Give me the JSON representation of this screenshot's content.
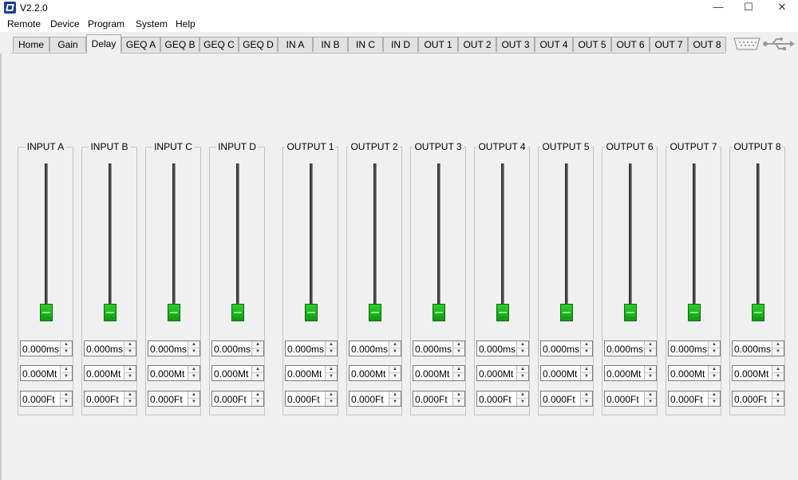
{
  "window": {
    "title": "V2.2.0",
    "minimize_glyph": "—",
    "maximize_glyph": "☐",
    "close_glyph": "✕"
  },
  "menu": [
    "Remote",
    "Device",
    "Program",
    "System",
    "Help"
  ],
  "tabs": [
    {
      "label": "Home",
      "active": false
    },
    {
      "label": "Gain",
      "active": false
    },
    {
      "label": "Delay",
      "active": true
    },
    {
      "label": "GEQ A",
      "active": false
    },
    {
      "label": "GEQ B",
      "active": false
    },
    {
      "label": "GEQ C",
      "active": false
    },
    {
      "label": "GEQ D",
      "active": false
    },
    {
      "label": "IN A",
      "active": false
    },
    {
      "label": "IN B",
      "active": false
    },
    {
      "label": "IN C",
      "active": false
    },
    {
      "label": "IN D",
      "active": false
    },
    {
      "label": "OUT 1",
      "active": false
    },
    {
      "label": "OUT 2",
      "active": false
    },
    {
      "label": "OUT 3",
      "active": false
    },
    {
      "label": "OUT 4",
      "active": false
    },
    {
      "label": "OUT 5",
      "active": false
    },
    {
      "label": "OUT 6",
      "active": false
    },
    {
      "label": "OUT 7",
      "active": false
    },
    {
      "label": "OUT 8",
      "active": false
    }
  ],
  "connector_icons": [
    "serial-port-icon",
    "usb-icon"
  ],
  "accent_color": "#1fb81f",
  "channels": [
    {
      "label": "INPUT A",
      "ms": "0.000ms",
      "mt": "0.000Mt",
      "ft": "0.000Ft",
      "level": 0
    },
    {
      "label": "INPUT B",
      "ms": "0.000ms",
      "mt": "0.000Mt",
      "ft": "0.000Ft",
      "level": 0
    },
    {
      "label": "INPUT C",
      "ms": "0.000ms",
      "mt": "0.000Mt",
      "ft": "0.000Ft",
      "level": 0
    },
    {
      "label": "INPUT D",
      "ms": "0.000ms",
      "mt": "0.000Mt",
      "ft": "0.000Ft",
      "level": 0
    },
    {
      "label": "OUTPUT 1",
      "ms": "0.000ms",
      "mt": "0.000Mt",
      "ft": "0.000Ft",
      "level": 0
    },
    {
      "label": "OUTPUT 2",
      "ms": "0.000ms",
      "mt": "0.000Mt",
      "ft": "0.000Ft",
      "level": 0
    },
    {
      "label": "OUTPUT 3",
      "ms": "0.000ms",
      "mt": "0.000Mt",
      "ft": "0.000Ft",
      "level": 0
    },
    {
      "label": "OUTPUT 4",
      "ms": "0.000ms",
      "mt": "0.000Mt",
      "ft": "0.000Ft",
      "level": 0
    },
    {
      "label": "OUTPUT 5",
      "ms": "0.000ms",
      "mt": "0.000Mt",
      "ft": "0.000Ft",
      "level": 0
    },
    {
      "label": "OUTPUT 6",
      "ms": "0.000ms",
      "mt": "0.000Mt",
      "ft": "0.000Ft",
      "level": 0
    },
    {
      "label": "OUTPUT 7",
      "ms": "0.000ms",
      "mt": "0.000Mt",
      "ft": "0.000Ft",
      "level": 0
    },
    {
      "label": "OUTPUT 8",
      "ms": "0.000ms",
      "mt": "0.000Mt",
      "ft": "0.000Ft",
      "level": 0
    }
  ]
}
